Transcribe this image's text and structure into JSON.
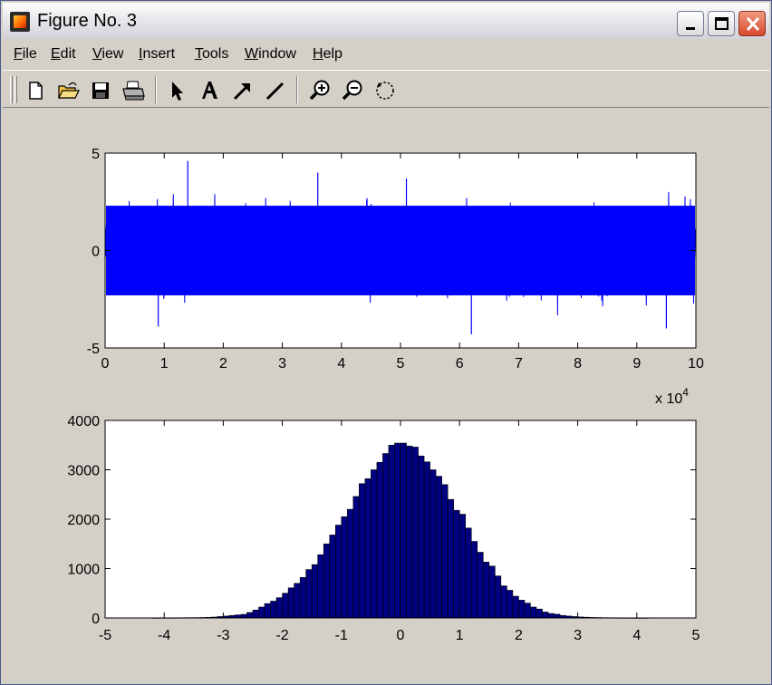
{
  "window": {
    "title": "Figure No. 3"
  },
  "menu": [
    {
      "u": "F",
      "rest": "ile"
    },
    {
      "u": "E",
      "rest": "dit"
    },
    {
      "u": "V",
      "rest": "iew"
    },
    {
      "u": "I",
      "rest": "nsert"
    },
    {
      "u": "T",
      "rest": "ools"
    },
    {
      "u": "W",
      "rest": "indow"
    },
    {
      "u": "H",
      "rest": "elp"
    }
  ],
  "toolbar": {
    "icons": [
      "new-file-icon",
      "open-folder-icon",
      "save-icon",
      "print-icon",
      "select-arrow-icon",
      "insert-text-icon",
      "insert-arrow-icon",
      "insert-line-icon",
      "zoom-in-icon",
      "zoom-out-icon",
      "rotate-icon"
    ]
  },
  "colors": {
    "signal": "#0000ff",
    "bars": "#000080",
    "background": "#d4d0c8"
  },
  "chart_data": [
    {
      "type": "line",
      "description_visible": "noise signal",
      "x_ticks": [
        0,
        1,
        2,
        3,
        4,
        5,
        6,
        7,
        8,
        9,
        10
      ],
      "x_multiplier": "x 10",
      "x_multiplier_exp": "4",
      "y_ticks": [
        -5,
        0,
        5
      ],
      "xlim": [
        0,
        100000
      ],
      "ylim": [
        -5,
        5
      ],
      "samples": 100000,
      "band_std": 1.0,
      "peak_max": 4.6,
      "peak_min": -4.3
    },
    {
      "type": "bar",
      "x_ticks": [
        -5,
        -4,
        -3,
        -2,
        -1,
        0,
        1,
        2,
        3,
        4,
        5
      ],
      "y_ticks": [
        0,
        1000,
        2000,
        3000,
        4000
      ],
      "xlim": [
        -5,
        5
      ],
      "ylim": [
        0,
        4000
      ],
      "bin_width": 0.1,
      "bin_start": -4.2,
      "counts": [
        2,
        3,
        3,
        3,
        4,
        5,
        6,
        7,
        9,
        12,
        18,
        28,
        38,
        50,
        62,
        72,
        110,
        160,
        220,
        290,
        340,
        410,
        500,
        610,
        700,
        820,
        980,
        1080,
        1280,
        1500,
        1680,
        1880,
        2050,
        2200,
        2460,
        2720,
        2820,
        3000,
        3150,
        3330,
        3500,
        3540,
        3540,
        3480,
        3460,
        3280,
        3160,
        3000,
        2870,
        2700,
        2400,
        2180,
        2100,
        1820,
        1550,
        1330,
        1130,
        1050,
        850,
        650,
        560,
        440,
        360,
        300,
        220,
        180,
        120,
        90,
        75,
        50,
        38,
        28,
        20,
        15,
        10,
        8,
        6,
        5,
        4,
        3,
        3,
        2,
        2,
        2
      ]
    }
  ]
}
